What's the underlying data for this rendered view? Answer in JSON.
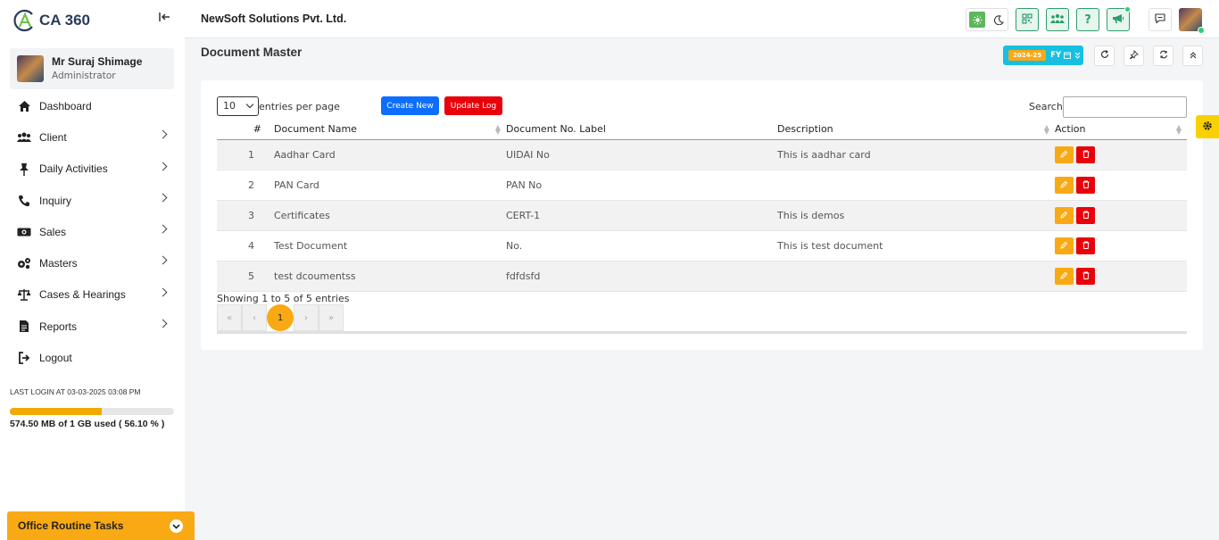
{
  "app": {
    "logo_text": "CA 360",
    "logo_sup": "°"
  },
  "user": {
    "name": "Mr Suraj Shimage",
    "role": "Administrator"
  },
  "sidebar": {
    "items": [
      {
        "label": "Dashboard",
        "icon": "home-icon",
        "has_children": false
      },
      {
        "label": "Client",
        "icon": "users-icon",
        "has_children": true
      },
      {
        "label": "Daily Activities",
        "icon": "pin-icon",
        "has_children": true
      },
      {
        "label": "Inquiry",
        "icon": "phone-icon",
        "has_children": true
      },
      {
        "label": "Sales",
        "icon": "money-icon",
        "has_children": true
      },
      {
        "label": "Masters",
        "icon": "gears-icon",
        "has_children": true
      },
      {
        "label": "Cases & Hearings",
        "icon": "scale-icon",
        "has_children": true
      },
      {
        "label": "Reports",
        "icon": "file-icon",
        "has_children": true
      },
      {
        "label": "Logout",
        "icon": "logout-icon",
        "has_children": false
      }
    ],
    "last_login": "LAST LOGIN AT 03-03-2025 03:08 PM",
    "storage_text": "574.50 MB of 1 GB used ( 56.10 % )",
    "storage_fraction": 0.561,
    "routine_label": "Office Routine Tasks"
  },
  "header": {
    "company": "NewSoft Solutions Pvt. Ltd."
  },
  "page": {
    "title": "Document Master",
    "fy_year": "2024-25",
    "fy_label": "FY"
  },
  "table": {
    "entries_value": "10",
    "entries_label": "entries per page",
    "create_label": "Create New",
    "log_label": "Update Log",
    "search_label": "Search:",
    "search_value": "",
    "columns": [
      "#",
      "Document Name",
      "Document No. Label",
      "Description",
      "Action"
    ],
    "rows": [
      {
        "no": "1",
        "name": "Aadhar Card",
        "label": "UIDAI No",
        "desc": "This is aadhar card"
      },
      {
        "no": "2",
        "name": "PAN Card",
        "label": "PAN No",
        "desc": ""
      },
      {
        "no": "3",
        "name": "Certificates",
        "label": "CERT-1",
        "desc": "This is demos"
      },
      {
        "no": "4",
        "name": "Test Document",
        "label": "No.",
        "desc": "This is test document"
      },
      {
        "no": "5",
        "name": "test dcoumentss",
        "label": "fdfdsfd",
        "desc": ""
      }
    ],
    "showing": "Showing 1 to 5 of 5 entries",
    "pager": {
      "first": "«",
      "prev": "‹",
      "current": "1",
      "next": "›",
      "last": "»"
    }
  },
  "colors": {
    "accent": "#f9a914",
    "primary": "#0d6efd",
    "danger": "#e8000b",
    "success": "#2e9e6b",
    "info": "#17c0e0"
  }
}
